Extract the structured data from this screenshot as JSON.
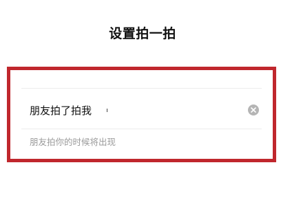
{
  "header": {
    "title": "设置拍一拍"
  },
  "pat_form": {
    "input_value": "朋友拍了拍我",
    "hint": "朋友拍你的时候将出现",
    "clear_icon": "clear-icon"
  },
  "colors": {
    "highlight_border": "#c0272d",
    "clear_icon_bg": "#b5b5b5",
    "hint_text": "#9a9a9a"
  }
}
